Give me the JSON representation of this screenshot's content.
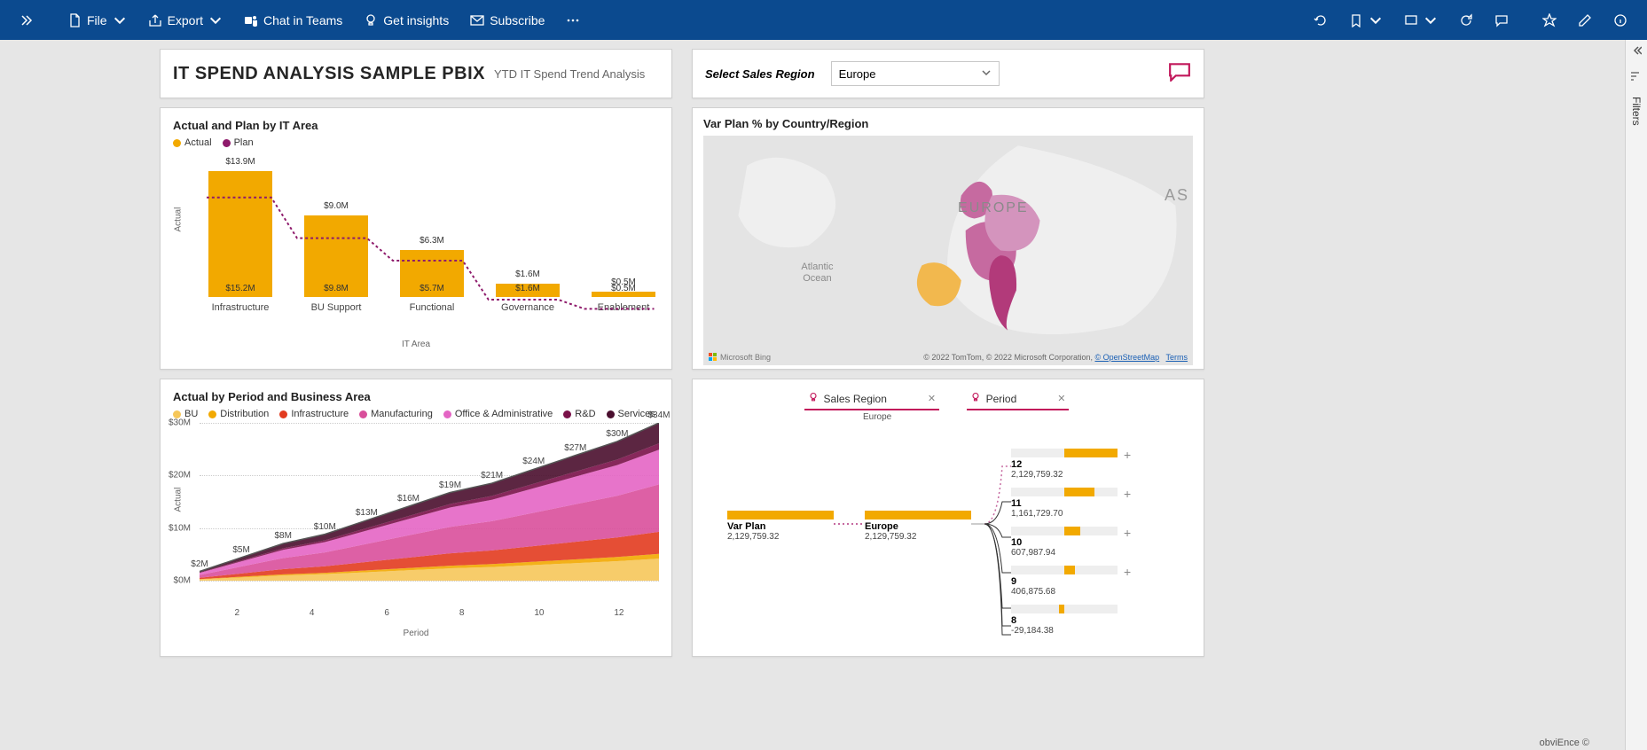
{
  "ribbon": {
    "file": "File",
    "export": "Export",
    "chat": "Chat in Teams",
    "insights": "Get insights",
    "subscribe": "Subscribe"
  },
  "title": {
    "main": "IT SPEND ANALYSIS SAMPLE PBIX",
    "sub": "YTD IT Spend Trend Analysis"
  },
  "slicer": {
    "label": "Select Sales Region",
    "value": "Europe"
  },
  "bar_chart": {
    "title": "Actual and Plan by IT Area",
    "legend": {
      "actual": "Actual",
      "plan": "Plan"
    },
    "xlabel": "IT Area",
    "ylabel": "Actual"
  },
  "map": {
    "title": "Var Plan % by Country/Region",
    "center": "EUROPE",
    "ocean_a": "Atlantic",
    "ocean_b": "Ocean",
    "as": "AS",
    "bing": "Microsoft Bing",
    "credit_a": "© 2022 TomTom, © 2022 Microsoft Corporation, ",
    "credit_link1": "© OpenStreetMap",
    "credit_link2": "Terms"
  },
  "area_chart": {
    "title": "Actual by Period and Business Area",
    "legend": [
      "BU",
      "Distribution",
      "Infrastructure",
      "Manufacturing",
      "Office & Administrative",
      "R&D",
      "Services"
    ],
    "xlabel": "Period",
    "ylabel": "Actual"
  },
  "tree": {
    "dim1": "Sales Region",
    "dim2": "Period",
    "dim1_sub": "Europe",
    "root_name": "Var Plan",
    "root_val": "2,129,759.32",
    "lvl2_name": "Europe",
    "lvl2_val": "2,129,759.32",
    "n12": "12",
    "v12": "2,129,759.32",
    "n11": "11",
    "v11": "1,161,729.70",
    "n10": "10",
    "v10": "607,987.94",
    "n9": "9",
    "v9": "406,875.68",
    "n8": "8",
    "v8": "-29,184.38"
  },
  "filters_label": "Filters",
  "footer": "obviEnce ©",
  "chart_data": [
    {
      "type": "bar",
      "title": "Actual and Plan by IT Area",
      "xlabel": "IT Area",
      "ylabel": "Actual",
      "categories": [
        "Infrastructure",
        "BU Support",
        "Functional",
        "Governance",
        "Enablement"
      ],
      "series": [
        {
          "name": "Actual",
          "values": [
            15.2,
            9.8,
            5.7,
            1.6,
            0.5
          ],
          "unit": "M$"
        },
        {
          "name": "Plan",
          "values": [
            13.9,
            9.0,
            6.3,
            1.6,
            0.5
          ],
          "unit": "M$"
        }
      ],
      "data_labels": {
        "actual_labels": [
          "$15.2M",
          "$9.8M",
          "$5.7M",
          "$1.6M",
          "$0.5M"
        ],
        "plan_labels": [
          "$13.9M",
          "$9.0M",
          "$6.3M",
          "$1.6M",
          "$0.5M"
        ]
      }
    },
    {
      "type": "area",
      "title": "Actual by Period and Business Area",
      "xlabel": "Period",
      "ylabel": "Actual",
      "x": [
        1,
        2,
        3,
        4,
        5,
        6,
        7,
        8,
        9,
        10,
        11,
        12
      ],
      "ylim": [
        0,
        34
      ],
      "y_ticks": [
        "$0M",
        "$10M",
        "$20M",
        "$30M"
      ],
      "stack_total_labels": [
        "$2M",
        "$5M",
        "$8M",
        "$10M",
        "$13M",
        "$16M",
        "$19M",
        "$21M",
        "$24M",
        "$27M",
        "$30M",
        "$34M"
      ],
      "stack_total_values": [
        2,
        5,
        8,
        10,
        13,
        16,
        19,
        21,
        24,
        27,
        30,
        34
      ],
      "series_names": [
        "BU",
        "Distribution",
        "Infrastructure",
        "Manufacturing",
        "Office & Administrative",
        "R&D",
        "Services"
      ]
    },
    {
      "type": "map",
      "title": "Var Plan % by Country/Region",
      "region_filter": "Europe",
      "note": "Choropleth of Var Plan % across European countries; darker magenta = higher variance"
    },
    {
      "type": "decomposition-tree",
      "measure": "Var Plan",
      "root_value": 2129759.32,
      "path": [
        "Sales Region = Europe",
        "Period"
      ],
      "level2": {
        "Europe": 2129759.32
      },
      "level3_by_period": {
        "12": 2129759.32,
        "11": 1161729.7,
        "10": 607987.94,
        "9": 406875.68,
        "8": -29184.38
      }
    }
  ]
}
